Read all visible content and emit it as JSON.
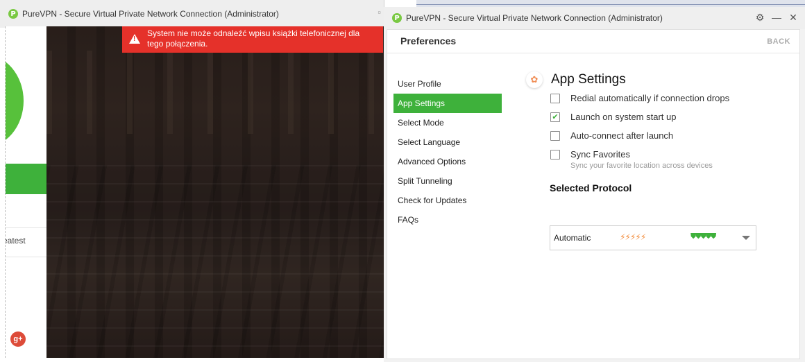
{
  "background_window": {
    "title": "PureVPN - Secure Virtual Private Network Connection (Administrator)",
    "error_message": "System nie może odnaleźć wpisu książki telefonicznej dla tego połączenia.",
    "partial_label": "eatest"
  },
  "window": {
    "title": "PureVPN - Secure Virtual Private Network Connection (Administrator)"
  },
  "preferences": {
    "title": "Preferences",
    "back_label": "BACK",
    "nav": [
      {
        "label": "User Profile"
      },
      {
        "label": "App Settings"
      },
      {
        "label": "Select Mode"
      },
      {
        "label": "Select Language"
      },
      {
        "label": "Advanced Options"
      },
      {
        "label": "Split Tunneling"
      },
      {
        "label": "Check for Updates"
      },
      {
        "label": "FAQs"
      }
    ],
    "active_nav_index": 1
  },
  "app_settings": {
    "title": "App Settings",
    "options": [
      {
        "label": "Redial automatically if connection drops",
        "checked": false
      },
      {
        "label": "Launch on system start up",
        "checked": true
      },
      {
        "label": "Auto-connect after launch",
        "checked": false
      },
      {
        "label": "Sync Favorites",
        "checked": false
      }
    ],
    "sync_description": "Sync your favorite location across devices",
    "protocol_title": "Selected Protocol",
    "protocol": {
      "name": "Automatic",
      "speed_rating": 5,
      "security_rating": 5
    }
  },
  "colors": {
    "accent": "#3eb13b",
    "error": "#e5312a",
    "speed": "#f28b3a"
  }
}
